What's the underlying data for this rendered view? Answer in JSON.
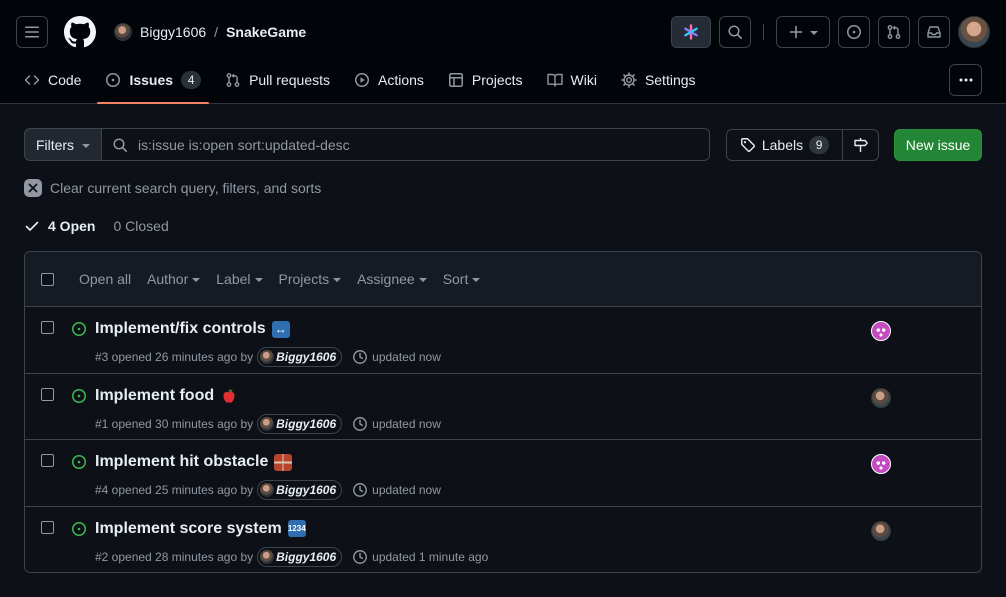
{
  "header": {
    "owner": "Biggy1606",
    "separator": "/",
    "repo": "SnakeGame",
    "icons": {
      "menu": "hamburger-icon",
      "logo": "github-mark-icon",
      "copilot": "copilot-icon",
      "search": "search-icon",
      "create": "plus-icon",
      "issues": "issue-opened-icon",
      "pulls": "git-pull-request-icon",
      "inbox": "inbox-icon"
    }
  },
  "nav": {
    "tabs": [
      {
        "label": "Code",
        "icon": "code-icon"
      },
      {
        "label": "Issues",
        "icon": "issue-opened-icon",
        "counter": "4",
        "active": true
      },
      {
        "label": "Pull requests",
        "icon": "git-pull-request-icon"
      },
      {
        "label": "Actions",
        "icon": "play-icon"
      },
      {
        "label": "Projects",
        "icon": "table-icon"
      },
      {
        "label": "Wiki",
        "icon": "book-icon"
      },
      {
        "label": "Settings",
        "icon": "gear-icon"
      }
    ]
  },
  "filterbar": {
    "filters_label": "Filters",
    "search_value": "is:issue is:open sort:updated-desc",
    "labels_label": "Labels",
    "labels_count": "9",
    "new_issue_label": "New issue"
  },
  "clear_label": "Clear current search query, filters, and sorts",
  "states": {
    "open": "4 Open",
    "closed": "0 Closed"
  },
  "list_header": {
    "open_all": "Open all",
    "author": "Author",
    "label": "Label",
    "projects": "Projects",
    "assignee": "Assignee",
    "sort": "Sort"
  },
  "issues": [
    {
      "title": "Implement/fix controls",
      "emoji": "↔",
      "number_opened": "#3 opened 26 minutes ago by",
      "author": "Biggy1606",
      "updated": "updated now",
      "assignee": "identicon"
    },
    {
      "title": "Implement food",
      "emoji": "🍎",
      "number_opened": "#1 opened 30 minutes ago by",
      "author": "Biggy1606",
      "updated": "updated now",
      "assignee": "photo"
    },
    {
      "title": "Implement hit obstacle",
      "emoji": "",
      "number_opened": "#4 opened 25 minutes ago by",
      "author": "Biggy1606",
      "updated": "updated now",
      "assignee": "identicon"
    },
    {
      "title": "Implement score system",
      "emoji": "1234",
      "number_opened": "#2 opened 28 minutes ago by",
      "author": "Biggy1606",
      "updated": "updated 1 minute ago",
      "assignee": "photo"
    }
  ],
  "colors": {
    "page_bg": "#0d1117",
    "header_bg": "#010409",
    "border": "#3d444d",
    "open_green": "#3fb950",
    "primary_button": "#238636",
    "active_tab_underline": "#f78166"
  }
}
